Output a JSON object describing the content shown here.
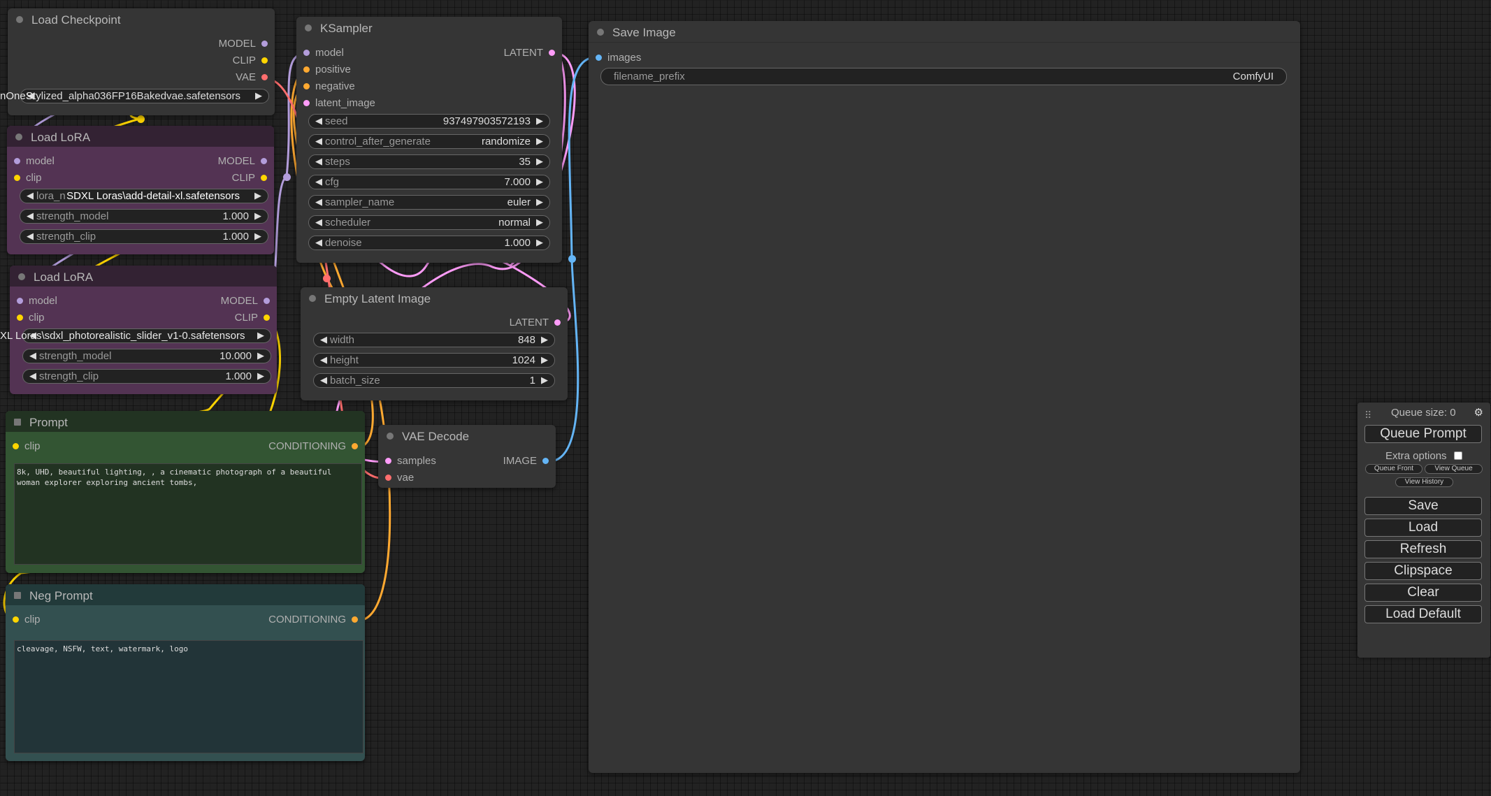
{
  "colors": {
    "model": "#b39ddb",
    "clip": "#ffd500",
    "vae": "#ff6e6e",
    "conditioning": "#ffa931",
    "latent": "#ff9cf9",
    "image": "#64b5f6"
  },
  "nodes": {
    "load_checkpoint": {
      "title": "Load Checkpoint",
      "outputs": [
        "MODEL",
        "CLIP",
        "VAE"
      ],
      "ckpt_value": "Stylized_alpha036FP16Bakedvae.safetensors",
      "ckpt_overflow": "nOneS"
    },
    "lora1": {
      "title": "Load LoRA",
      "inputs": [
        "model",
        "clip"
      ],
      "outputs": [
        "MODEL",
        "CLIP"
      ],
      "lora_name_label": "lora_n",
      "lora_name_value": "SDXL Loras\\add-detail-xl.safetensors",
      "strength_model_label": "strength_model",
      "strength_model": "1.000",
      "strength_clip_label": "strength_clip",
      "strength_clip": "1.000"
    },
    "lora2": {
      "title": "Load LoRA",
      "inputs": [
        "model",
        "clip"
      ],
      "outputs": [
        "MODEL",
        "CLIP"
      ],
      "lora_name_value": "XL Loras\\sdxl_photorealistic_slider_v1-0.safetensors",
      "strength_model_label": "strength_model",
      "strength_model": "10.000",
      "strength_clip_label": "strength_clip",
      "strength_clip": "1.000"
    },
    "prompt": {
      "title": "Prompt",
      "input": "clip",
      "output": "CONDITIONING",
      "text": "8k, UHD, beautiful lighting, , a cinematic photograph of a beautiful\nwoman explorer exploring ancient tombs,"
    },
    "neg_prompt": {
      "title": "Neg Prompt",
      "input": "clip",
      "output": "CONDITIONING",
      "text": "cleavage, NSFW, text, watermark, logo"
    },
    "ksampler": {
      "title": "KSampler",
      "inputs": [
        "model",
        "positive",
        "negative",
        "latent_image"
      ],
      "output": "LATENT",
      "widgets": [
        {
          "label": "seed",
          "value": "937497903572193"
        },
        {
          "label": "control_after_generate",
          "value": "randomize"
        },
        {
          "label": "steps",
          "value": "35"
        },
        {
          "label": "cfg",
          "value": "7.000"
        },
        {
          "label": "sampler_name",
          "value": "euler"
        },
        {
          "label": "scheduler",
          "value": "normal"
        },
        {
          "label": "denoise",
          "value": "1.000"
        }
      ]
    },
    "empty_latent": {
      "title": "Empty Latent Image",
      "output": "LATENT",
      "widgets": [
        {
          "label": "width",
          "value": "848"
        },
        {
          "label": "height",
          "value": "1024"
        },
        {
          "label": "batch_size",
          "value": "1"
        }
      ]
    },
    "vae_decode": {
      "title": "VAE Decode",
      "inputs": [
        "samples",
        "vae"
      ],
      "output": "IMAGE"
    },
    "save_image": {
      "title": "Save Image",
      "input": "images",
      "filename_prefix_label": "filename_prefix",
      "filename_prefix": "ComfyUI"
    }
  },
  "menu": {
    "queue_size": "Queue size: 0",
    "gear_icon": "gear-icon",
    "queue_prompt": "Queue Prompt",
    "extra_options": "Extra options",
    "queue_front": "Queue Front",
    "view_queue": "View Queue",
    "view_history": "View History",
    "save": "Save",
    "load": "Load",
    "refresh": "Refresh",
    "clipspace": "Clipspace",
    "clear": "Clear",
    "load_default": "Load Default"
  }
}
